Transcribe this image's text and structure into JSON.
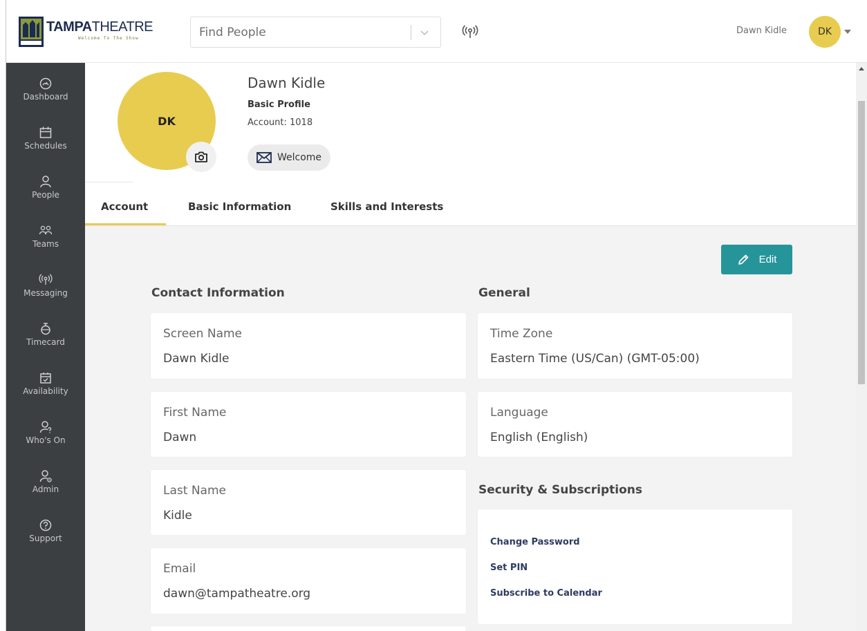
{
  "header": {
    "logo": {
      "brand_bold": "TAMPA",
      "brand_thin": "THEATRE",
      "tagline": "Welcome To The Show"
    },
    "search": {
      "placeholder": "Find People"
    },
    "user": {
      "name": "Dawn Kidle",
      "initials": "DK"
    }
  },
  "sidebar": {
    "items": [
      {
        "label": "Dashboard",
        "icon": "dashboard-icon"
      },
      {
        "label": "Schedules",
        "icon": "calendar-icon"
      },
      {
        "label": "People",
        "icon": "person-icon"
      },
      {
        "label": "Teams",
        "icon": "teams-icon"
      },
      {
        "label": "Messaging",
        "icon": "broadcast-icon"
      },
      {
        "label": "Timecard",
        "icon": "stopwatch-icon"
      },
      {
        "label": "Availability",
        "icon": "calendar-check-icon"
      },
      {
        "label": "Who's On",
        "icon": "person-question-icon"
      },
      {
        "label": "Admin",
        "icon": "person-gear-icon"
      },
      {
        "label": "Support",
        "icon": "help-circle-icon"
      }
    ]
  },
  "profile": {
    "initials": "DK",
    "name": "Dawn Kidle",
    "type": "Basic Profile",
    "account": "Account: 1018",
    "welcome_label": "Welcome"
  },
  "tabs": [
    {
      "label": "Account",
      "active": true
    },
    {
      "label": "Basic Information",
      "active": false
    },
    {
      "label": "Skills and Interests",
      "active": false
    }
  ],
  "content": {
    "edit_label": "Edit",
    "contact_title": "Contact Information",
    "contact_fields": [
      {
        "label": "Screen Name",
        "value": "Dawn Kidle"
      },
      {
        "label": "First Name",
        "value": "Dawn"
      },
      {
        "label": "Last Name",
        "value": "Kidle"
      },
      {
        "label": "Email",
        "value": "dawn@tampatheatre.org"
      }
    ],
    "general_title": "General",
    "general_fields": [
      {
        "label": "Time Zone",
        "value": "Eastern Time (US/Can) (GMT-05:00)"
      },
      {
        "label": "Language",
        "value": "English (English)"
      }
    ],
    "security_title": "Security & Subscriptions",
    "security_links": [
      {
        "label": "Change Password"
      },
      {
        "label": "Set PIN"
      },
      {
        "label": "Subscribe to Calendar"
      }
    ]
  },
  "colors": {
    "accent_yellow": "#e8cc50",
    "edit_teal": "#26959a",
    "sidebar_bg": "#3b3f42",
    "link_navy": "#2f3a60"
  }
}
